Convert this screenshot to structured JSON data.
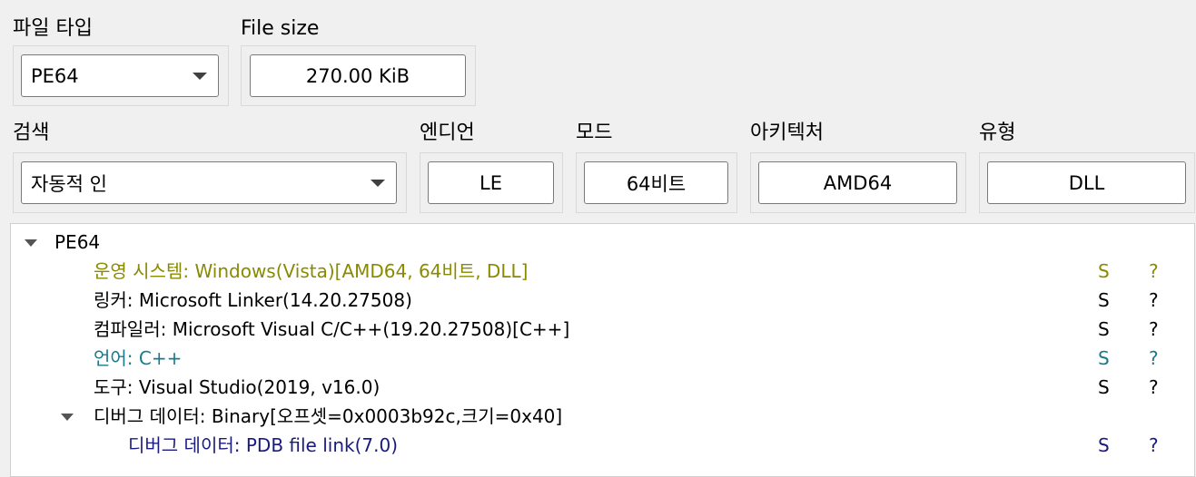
{
  "file_type": {
    "label": "파일 타입",
    "value": "PE64"
  },
  "file_size": {
    "label": "File size",
    "value": "270.00 KiB"
  },
  "scan": {
    "label": "검색",
    "value": "자동적 인"
  },
  "endian": {
    "label": "엔디언",
    "value": "LE"
  },
  "mode": {
    "label": "모드",
    "value": "64비트"
  },
  "arch": {
    "label": "아키텍처",
    "value": "AMD64"
  },
  "type": {
    "label": "유형",
    "value": "DLL"
  },
  "colors": {
    "os": "#8a8a00",
    "language": "#1a7a8a",
    "debug": "#1a1a80",
    "default": "#000000"
  },
  "tree": {
    "root": {
      "text": "PE64",
      "expanded": true
    },
    "items": [
      {
        "text": "운영 시스템: Windows(Vista)[AMD64, 64비트, DLL]",
        "color_key": "os",
        "s": "S",
        "q": "?"
      },
      {
        "text": "링커: Microsoft Linker(14.20.27508)",
        "color_key": "default",
        "s": "S",
        "q": "?"
      },
      {
        "text": "컴파일러: Microsoft Visual C/C++(19.20.27508)[C++]",
        "color_key": "default",
        "s": "S",
        "q": "?"
      },
      {
        "text": "언어: C++",
        "color_key": "language",
        "s": "S",
        "q": "?"
      },
      {
        "text": "도구: Visual Studio(2019, v16.0)",
        "color_key": "default",
        "s": "S",
        "q": "?"
      },
      {
        "text": "디버그 데이터: Binary[오프셋=0x0003b92c,크기=0x40]",
        "color_key": "default",
        "expanded": true
      },
      {
        "text": "디버그 데이터: PDB file link(7.0)",
        "color_key": "debug",
        "s": "S",
        "q": "?"
      }
    ]
  }
}
